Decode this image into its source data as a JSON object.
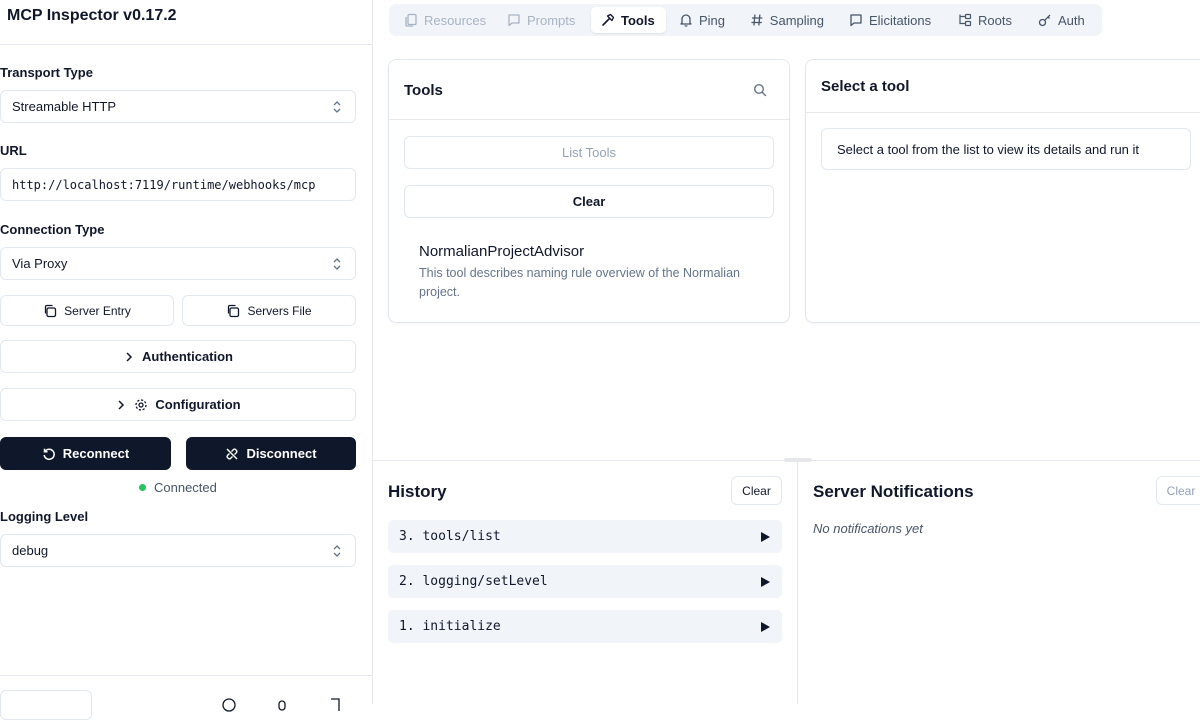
{
  "sidebar": {
    "title": "MCP Inspector v0.17.2",
    "transport_label": "Transport Type",
    "transport_value": "Streamable HTTP",
    "url_label": "URL",
    "url_value": "http://localhost:7119/runtime/webhooks/mcp",
    "connection_label": "Connection Type",
    "connection_value": "Via Proxy",
    "server_entry_label": "Server Entry",
    "servers_file_label": "Servers File",
    "authentication_label": "Authentication",
    "configuration_label": "Configuration",
    "reconnect_label": "Reconnect",
    "disconnect_label": "Disconnect",
    "status_text": "Connected",
    "logging_label": "Logging Level",
    "logging_value": "debug"
  },
  "tabs": [
    {
      "label": "Resources",
      "icon": "files-icon"
    },
    {
      "label": "Prompts",
      "icon": "message-icon"
    },
    {
      "label": "Tools",
      "icon": "hammer-icon"
    },
    {
      "label": "Ping",
      "icon": "bell-icon"
    },
    {
      "label": "Sampling",
      "icon": "hash-icon"
    },
    {
      "label": "Elicitations",
      "icon": "message-square-icon"
    },
    {
      "label": "Roots",
      "icon": "folder-tree-icon"
    },
    {
      "label": "Auth",
      "icon": "key-icon"
    }
  ],
  "tools_panel": {
    "title": "Tools",
    "list_button": "List Tools",
    "clear_button": "Clear",
    "tool": {
      "name": "NormalianProjectAdvisor",
      "description": "This tool describes naming rule overview of the Normalian project."
    }
  },
  "detail_panel": {
    "title": "Select a tool",
    "message": "Select a tool from the list to view its details and run it"
  },
  "history": {
    "title": "History",
    "clear_button": "Clear",
    "items": [
      "3. tools/list",
      "2. logging/setLevel",
      "1. initialize"
    ]
  },
  "notifications": {
    "title": "Server Notifications",
    "clear_button": "Clear",
    "empty_text": "No notifications yet"
  },
  "colors": {
    "dark_button": "#0f172a",
    "status_dot": "#22c55e",
    "tab_bar": "#f1f5f9"
  }
}
